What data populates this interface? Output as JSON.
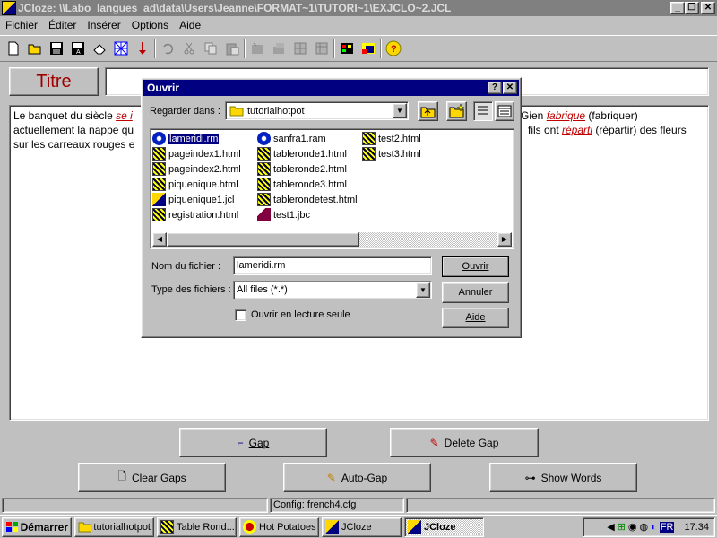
{
  "window": {
    "title": "JCloze: \\\\Labo_langues_ad\\data\\Users\\Jeanne\\FORMAT~1\\TUTORI~1\\EXJCLO~2.JCL"
  },
  "menu": [
    "Fichier",
    "Éditer",
    "Insérer",
    "Options",
    "Aide"
  ],
  "toolbar_icons": [
    "new-icon",
    "open-icon",
    "save-icon",
    "save-as-icon",
    "eraser-icon",
    "web-icon",
    "down-arrow-icon",
    "undo-icon",
    "cut-icon",
    "copy-icon",
    "paste-icon",
    "tool1-icon",
    "tool2-icon",
    "tool3-icon",
    "tool4-icon",
    "palette-icon",
    "flag-icon",
    "help-icon"
  ],
  "title_label": "Titre",
  "body": {
    "text1": "Le banquet du siècle ",
    "gap1": "se i",
    "text2": "actuellement la nappe qu",
    "text3": "sur les carreaux rouges e",
    "right1a": "Gien ",
    "gap2": "fabrique",
    "right1b": " (fabriquer)",
    "right2a": "fils ont ",
    "gap3": "réparti",
    "right2b": " (répartir) des fleurs"
  },
  "buttons": {
    "gap": "Gap",
    "delete_gap": "Delete Gap",
    "clear_gaps": "Clear Gaps",
    "auto_gap": "Auto-Gap",
    "show_words": "Show Words"
  },
  "status": {
    "config": "Config: french4.cfg"
  },
  "dialog": {
    "title": "Ouvrir",
    "look_in_label": "Regarder dans :",
    "look_in_value": "tutorialhotpot",
    "files": [
      {
        "name": "lameridi.rm",
        "icon": "realmedia-icon",
        "selected": true
      },
      {
        "name": "pageindex1.html",
        "icon": "webpage-icon"
      },
      {
        "name": "pageindex2.html",
        "icon": "webpage-icon"
      },
      {
        "name": "piquenique.html",
        "icon": "webpage-icon"
      },
      {
        "name": "piquenique1.jcl",
        "icon": "jcloze-file-icon"
      },
      {
        "name": "registration.html",
        "icon": "webpage-icon"
      },
      {
        "name": "sanfra1.ram",
        "icon": "realmedia-icon"
      },
      {
        "name": "tableronde1.html",
        "icon": "webpage-icon"
      },
      {
        "name": "tableronde2.html",
        "icon": "webpage-icon"
      },
      {
        "name": "tableronde3.html",
        "icon": "webpage-icon"
      },
      {
        "name": "tablerondetest.html",
        "icon": "webpage-icon"
      },
      {
        "name": "test1.jbc",
        "icon": "jbc-file-icon"
      },
      {
        "name": "test2.html",
        "icon": "webpage-icon"
      },
      {
        "name": "test3.html",
        "icon": "webpage-icon"
      }
    ],
    "filename_label": "Nom du fichier :",
    "filename_value": "lameridi.rm",
    "filetype_label": "Type des fichiers :",
    "filetype_value": "All files (*.*)",
    "readonly_label": "Ouvrir en lecture seule",
    "open_button": "Ouvrir",
    "cancel_button": "Annuler",
    "help_button": "Aide"
  },
  "taskbar": {
    "start": "Démarrer",
    "tasks": [
      "tutorialhotpot",
      "Table Rond...",
      "Hot Potatoes",
      "JCloze",
      "JCloze"
    ],
    "lang": "FR",
    "time": "17:34"
  }
}
